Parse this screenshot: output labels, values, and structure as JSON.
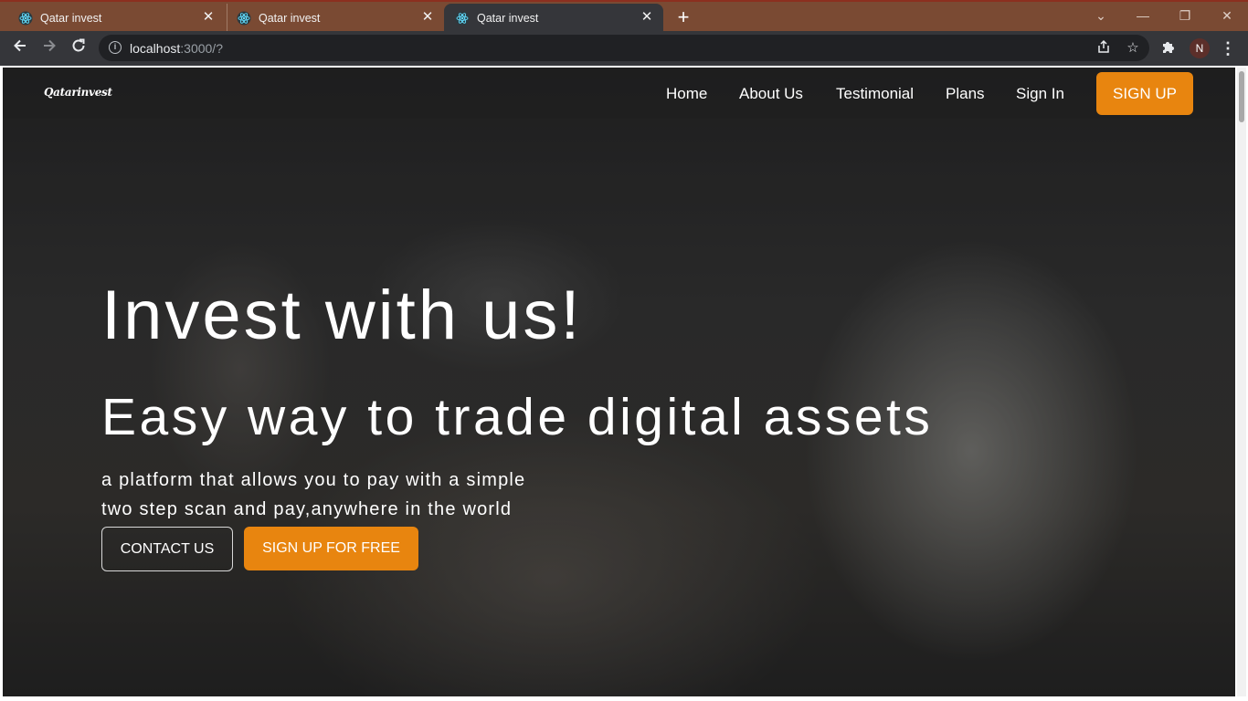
{
  "browser": {
    "tabs": [
      {
        "title": "Qatar invest",
        "icon": "react-icon",
        "active": false
      },
      {
        "title": "Qatar invest",
        "icon": "react-icon",
        "active": false
      },
      {
        "title": "Qatar invest",
        "icon": "react-icon",
        "active": true
      }
    ],
    "url_host": "localhost",
    "url_rest": ":3000/?",
    "profile_initial": "N"
  },
  "site": {
    "logo": "Qatarinvest",
    "nav": {
      "home": "Home",
      "about": "About Us",
      "testimonial": "Testimonial",
      "plans": "Plans",
      "signin": "Sign In",
      "signup": "SIGN UP"
    },
    "hero": {
      "title": "Invest with us!",
      "subtitle": "Easy way to trade digital assets",
      "desc_line1": "a platform that allows you to pay with a simple",
      "desc_line2": "two step scan and pay,anywhere in the world",
      "contact_label": "CONTACT US",
      "signup_label": "SIGN UP FOR FREE"
    }
  },
  "colors": {
    "accent": "#e8850f",
    "tabstrip": "#7a4a33",
    "toolbar": "#35363a"
  }
}
